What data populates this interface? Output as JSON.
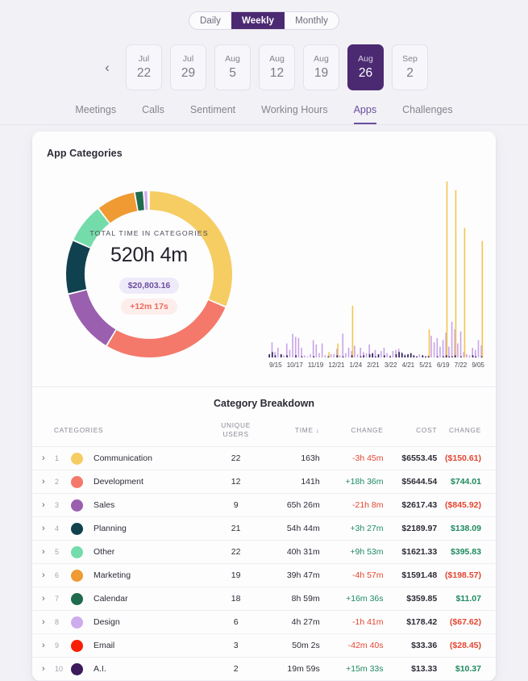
{
  "header": {
    "period_toggle": {
      "options": [
        "Daily",
        "Weekly",
        "Monthly"
      ],
      "selected": "Weekly"
    },
    "prev_arrow_icon": "chevron-left-icon",
    "weeks": [
      {
        "month": "Jul",
        "day": "22",
        "selected": false
      },
      {
        "month": "Jul",
        "day": "29",
        "selected": false
      },
      {
        "month": "Aug",
        "day": "5",
        "selected": false
      },
      {
        "month": "Aug",
        "day": "12",
        "selected": false
      },
      {
        "month": "Aug",
        "day": "19",
        "selected": false
      },
      {
        "month": "Aug",
        "day": "26",
        "selected": true
      },
      {
        "month": "Sep",
        "day": "2",
        "selected": false
      }
    ],
    "tabs": [
      "Meetings",
      "Calls",
      "Sentiment",
      "Working Hours",
      "Apps",
      "Challenges"
    ],
    "active_tab": "Apps"
  },
  "card": {
    "title": "App Categories",
    "donut_center": {
      "label": "TOTAL TIME IN CATEGORIES",
      "total": "520h 4m",
      "cost_pill": "$20,803.16",
      "delta_pill": "+12m 17s"
    }
  },
  "table": {
    "title": "Category Breakdown",
    "columns": [
      "CATEGORIES",
      "UNIQUE USERS",
      "TIME",
      "CHANGE",
      "COST",
      "CHANGE"
    ],
    "users_header_line1": "UNIQUE",
    "users_header_line2": "USERS",
    "time_header": "TIME",
    "sort_icon": "arrow-down-icon",
    "rows": [
      {
        "rank": "1",
        "name": "Communication",
        "color": "#f5cd63",
        "users": "22",
        "time": "163h",
        "time_change": "-3h 45m",
        "time_dir": "down",
        "cost": "$6553.45",
        "cost_change": "($150.61)",
        "cost_dir": "down"
      },
      {
        "rank": "2",
        "name": "Development",
        "color": "#f4796a",
        "users": "12",
        "time": "141h",
        "time_change": "+18h 36m",
        "time_dir": "up",
        "cost": "$5644.54",
        "cost_change": "$744.01",
        "cost_dir": "up"
      },
      {
        "rank": "3",
        "name": "Sales",
        "color": "#9a5fae",
        "users": "9",
        "time": "65h 26m",
        "time_change": "-21h 8m",
        "time_dir": "down",
        "cost": "$2617.43",
        "cost_change": "($845.92)",
        "cost_dir": "down"
      },
      {
        "rank": "4",
        "name": "Planning",
        "color": "#10414f",
        "users": "21",
        "time": "54h 44m",
        "time_change": "+3h 27m",
        "time_dir": "up",
        "cost": "$2189.97",
        "cost_change": "$138.09",
        "cost_dir": "up"
      },
      {
        "rank": "5",
        "name": "Other",
        "color": "#74dcaa",
        "users": "22",
        "time": "40h 31m",
        "time_change": "+9h 53m",
        "time_dir": "up",
        "cost": "$1621.33",
        "cost_change": "$395.83",
        "cost_dir": "up"
      },
      {
        "rank": "6",
        "name": "Marketing",
        "color": "#ef9a32",
        "users": "19",
        "time": "39h 47m",
        "time_change": "-4h 57m",
        "time_dir": "down",
        "cost": "$1591.48",
        "cost_change": "($198.57)",
        "cost_dir": "down"
      },
      {
        "rank": "7",
        "name": "Calendar",
        "color": "#1f6b4d",
        "users": "18",
        "time": "8h 59m",
        "time_change": "+16m 36s",
        "time_dir": "up",
        "cost": "$359.85",
        "cost_change": "$11.07",
        "cost_dir": "up"
      },
      {
        "rank": "8",
        "name": "Design",
        "color": "#cdaced",
        "users": "6",
        "time": "4h 27m",
        "time_change": "-1h 41m",
        "time_dir": "down",
        "cost": "$178.42",
        "cost_change": "($67.62)",
        "cost_dir": "down"
      },
      {
        "rank": "9",
        "name": "Email",
        "color": "#f81e07",
        "users": "3",
        "time": "50m 2s",
        "time_change": "-42m 40s",
        "time_dir": "down",
        "cost": "$33.36",
        "cost_change": "($28.45)",
        "cost_dir": "down"
      },
      {
        "rank": "10",
        "name": "A.I.",
        "color": "#3d1a5b",
        "users": "2",
        "time": "19m 59s",
        "time_change": "+15m 33s",
        "time_dir": "up",
        "cost": "$13.33",
        "cost_change": "$10.37",
        "cost_dir": "up"
      }
    ]
  },
  "chart_data": [
    {
      "type": "pie",
      "title": "App Categories",
      "subtitle": "TOTAL TIME IN CATEGORIES",
      "center_value": "520h 4m",
      "categories": [
        "Communication",
        "Development",
        "Sales",
        "Planning",
        "Other",
        "Marketing",
        "Calendar",
        "Design",
        "Email",
        "A.I."
      ],
      "values": [
        163.0,
        141.0,
        65.43,
        54.73,
        40.52,
        39.78,
        8.98,
        4.45,
        0.83,
        0.33
      ],
      "unit": "hours",
      "colors": [
        "#f5cd63",
        "#f4796a",
        "#9a5fae",
        "#10414f",
        "#74dcaa",
        "#ef9a32",
        "#1f6b4d",
        "#cdaced",
        "#f81e07",
        "#3d1a5b"
      ],
      "legend": "none",
      "donut": true
    },
    {
      "type": "bar",
      "title": "",
      "xlabel": "",
      "ylabel": "",
      "grid": false,
      "legend": "none",
      "tick_labels": [
        "9/15",
        "10/17",
        "11/19",
        "12/21",
        "1/24",
        "2/21",
        "3/22",
        "4/21",
        "5/21",
        "6/19",
        "7/22",
        "9/05"
      ],
      "series": [
        {
          "name": "lavender",
          "color": "#c9a3e8",
          "values": [
            2,
            14,
            5,
            9,
            3,
            2,
            13,
            7,
            22,
            19,
            18,
            9,
            2,
            1,
            3,
            16,
            12,
            4,
            13,
            2,
            1,
            3,
            3,
            8,
            2,
            22,
            4,
            9,
            6,
            11,
            3,
            9,
            5,
            4,
            12,
            3,
            7,
            2,
            6,
            9,
            4,
            2,
            6,
            7,
            8,
            5,
            3,
            2,
            1,
            2,
            1,
            3,
            2,
            1,
            2,
            20,
            14,
            18,
            10,
            16,
            23,
            10,
            33,
            26,
            13,
            24,
            5,
            3,
            2,
            9,
            7,
            16,
            11
          ]
        },
        {
          "name": "amber",
          "color": "#f5c44e",
          "values": [
            0,
            0,
            0,
            0,
            0,
            0,
            0,
            0,
            0,
            0,
            0,
            0,
            0,
            0,
            0,
            1,
            0,
            0,
            0,
            0,
            5,
            0,
            0,
            13,
            0,
            0,
            0,
            0,
            48,
            0,
            0,
            0,
            0,
            0,
            0,
            0,
            0,
            0,
            0,
            0,
            0,
            0,
            0,
            0,
            0,
            0,
            0,
            0,
            0,
            0,
            0,
            0,
            0,
            0,
            26,
            0,
            0,
            0,
            0,
            0,
            163,
            0,
            0,
            155,
            0,
            0,
            120,
            0,
            0,
            0,
            0,
            0,
            108
          ]
        },
        {
          "name": "navy",
          "color": "#2a2250",
          "values": [
            3,
            5,
            2,
            0,
            3,
            0,
            2,
            0,
            0,
            2,
            0,
            1,
            0,
            0,
            0,
            1,
            0,
            0,
            0,
            0,
            1,
            0,
            0,
            2,
            0,
            1,
            0,
            0,
            2,
            0,
            0,
            1,
            2,
            0,
            3,
            4,
            1,
            3,
            0,
            2,
            0,
            1,
            0,
            3,
            5,
            4,
            2,
            3,
            4,
            2,
            1,
            0,
            2,
            1,
            1,
            0,
            0,
            1,
            0,
            1,
            2,
            1,
            1,
            2,
            0,
            1,
            0,
            0,
            0,
            2,
            1,
            0,
            1
          ]
        }
      ]
    }
  ]
}
